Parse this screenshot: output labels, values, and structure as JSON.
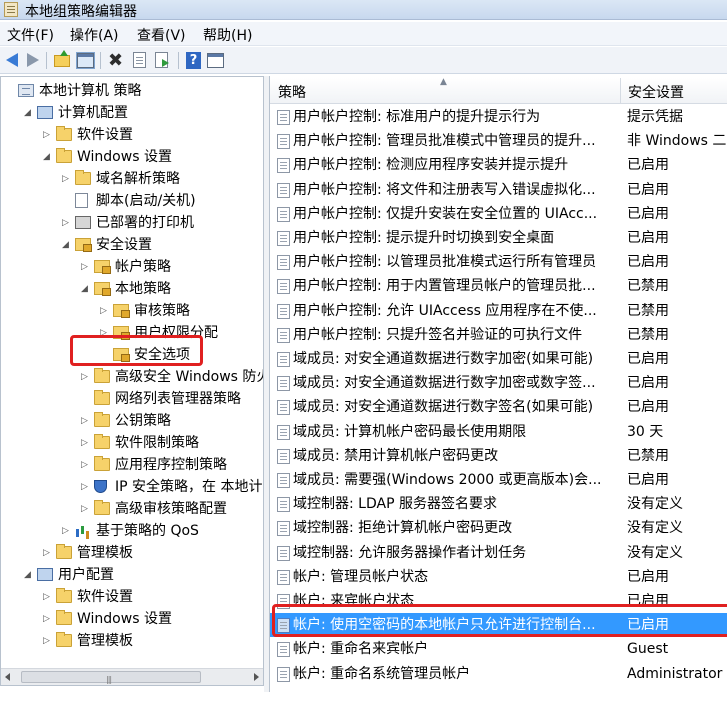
{
  "window": {
    "title": "本地组策略编辑器"
  },
  "menu": [
    "文件(F)",
    "操作(A)",
    "查看(V)",
    "帮助(H)"
  ],
  "toolbar": {
    "buttons": [
      "back-icon",
      "forward-icon",
      "up-folder-icon",
      "show-hide-tree-icon",
      "delete-icon",
      "properties-icon",
      "export-list-icon",
      "help-icon",
      "show-hide-action-pane-icon"
    ]
  },
  "tree": [
    {
      "label": "本地计算机 策略",
      "icon": "computer-policy-icon",
      "exp": ""
    },
    {
      "label": "计算机配置",
      "icon": "computer-icon",
      "exp": "◢"
    },
    {
      "label": "软件设置",
      "icon": "folder-icon",
      "exp": "▷"
    },
    {
      "label": "Windows 设置",
      "icon": "folder-icon",
      "exp": "◢"
    },
    {
      "label": "域名解析策略",
      "icon": "folder-icon",
      "exp": "▷"
    },
    {
      "label": "脚本(启动/关机)",
      "icon": "script-icon",
      "exp": ""
    },
    {
      "label": "已部署的打印机",
      "icon": "printer-icon",
      "exp": "▷"
    },
    {
      "label": "安全设置",
      "icon": "security-settings-icon",
      "exp": "◢"
    },
    {
      "label": "帐户策略",
      "icon": "folder-lock-icon",
      "exp": "▷"
    },
    {
      "label": "本地策略",
      "icon": "folder-lock-icon",
      "exp": "◢"
    },
    {
      "label": "审核策略",
      "icon": "folder-lock-icon",
      "exp": "▷"
    },
    {
      "label": "用户权限分配",
      "icon": "folder-lock-icon",
      "exp": "▷"
    },
    {
      "label": "安全选项",
      "icon": "folder-lock-icon",
      "exp": ""
    },
    {
      "label": "高级安全 Windows 防火",
      "icon": "folder-icon",
      "exp": "▷"
    },
    {
      "label": "网络列表管理器策略",
      "icon": "folder-icon",
      "exp": ""
    },
    {
      "label": "公钥策略",
      "icon": "folder-icon",
      "exp": "▷"
    },
    {
      "label": "软件限制策略",
      "icon": "folder-icon",
      "exp": "▷"
    },
    {
      "label": "应用程序控制策略",
      "icon": "folder-icon",
      "exp": "▷"
    },
    {
      "label": "IP 安全策略，在 本地计算",
      "icon": "ip-security-icon",
      "exp": "▷"
    },
    {
      "label": "高级审核策略配置",
      "icon": "folder-icon",
      "exp": "▷"
    },
    {
      "label": "基于策略的 QoS",
      "icon": "qos-chart-icon",
      "exp": "▷"
    },
    {
      "label": "管理模板",
      "icon": "folder-icon",
      "exp": "▷"
    },
    {
      "label": "用户配置",
      "icon": "user-icon",
      "exp": "◢"
    },
    {
      "label": "软件设置",
      "icon": "folder-icon",
      "exp": "▷"
    },
    {
      "label": "Windows 设置",
      "icon": "folder-icon",
      "exp": "▷"
    },
    {
      "label": "管理模板",
      "icon": "folder-icon",
      "exp": "▷"
    }
  ],
  "list": {
    "col_policy": "策略",
    "col_setting": "安全设置",
    "rows": [
      {
        "policy": "用户帐户控制: 标准用户的提升提示行为",
        "setting": "提示凭据"
      },
      {
        "policy": "用户帐户控制: 管理员批准模式中管理员的提升...",
        "setting": "非 Windows 二"
      },
      {
        "policy": "用户帐户控制: 检测应用程序安装并提示提升",
        "setting": "已启用"
      },
      {
        "policy": "用户帐户控制: 将文件和注册表写入错误虚拟化...",
        "setting": "已启用"
      },
      {
        "policy": "用户帐户控制: 仅提升安装在安全位置的 UIAcc...",
        "setting": "已启用"
      },
      {
        "policy": "用户帐户控制: 提示提升时切换到安全桌面",
        "setting": "已启用"
      },
      {
        "policy": "用户帐户控制: 以管理员批准模式运行所有管理员",
        "setting": "已启用"
      },
      {
        "policy": "用户帐户控制: 用于内置管理员帐户的管理员批...",
        "setting": "已禁用"
      },
      {
        "policy": "用户帐户控制: 允许 UIAccess 应用程序在不使...",
        "setting": "已禁用"
      },
      {
        "policy": "用户帐户控制: 只提升签名并验证的可执行文件",
        "setting": "已禁用"
      },
      {
        "policy": "域成员: 对安全通道数据进行数字加密(如果可能)",
        "setting": "已启用"
      },
      {
        "policy": "域成员: 对安全通道数据进行数字加密或数字签...",
        "setting": "已启用"
      },
      {
        "policy": "域成员: 对安全通道数据进行数字签名(如果可能)",
        "setting": "已启用"
      },
      {
        "policy": "域成员: 计算机帐户密码最长使用期限",
        "setting": "30 天"
      },
      {
        "policy": "域成员: 禁用计算机帐户密码更改",
        "setting": "已禁用"
      },
      {
        "policy": "域成员: 需要强(Windows 2000 或更高版本)会...",
        "setting": "已启用"
      },
      {
        "policy": "域控制器: LDAP 服务器签名要求",
        "setting": "没有定义"
      },
      {
        "policy": "域控制器: 拒绝计算机帐户密码更改",
        "setting": "没有定义"
      },
      {
        "policy": "域控制器: 允许服务器操作者计划任务",
        "setting": "没有定义"
      },
      {
        "policy": "帐户: 管理员帐户状态",
        "setting": "已启用"
      },
      {
        "policy": "帐户: 来宾帐户状态",
        "setting": "已启用"
      },
      {
        "policy": "帐户: 使用空密码的本地帐户只允许进行控制台...",
        "setting": "已启用"
      },
      {
        "policy": "帐户: 重命名来宾帐户",
        "setting": "Guest"
      },
      {
        "policy": "帐户: 重命名系统管理员帐户",
        "setting": "Administrator"
      }
    ],
    "selected_index": 21
  },
  "colors": {
    "selection": "#3399ff",
    "highlight": "#e02020"
  }
}
